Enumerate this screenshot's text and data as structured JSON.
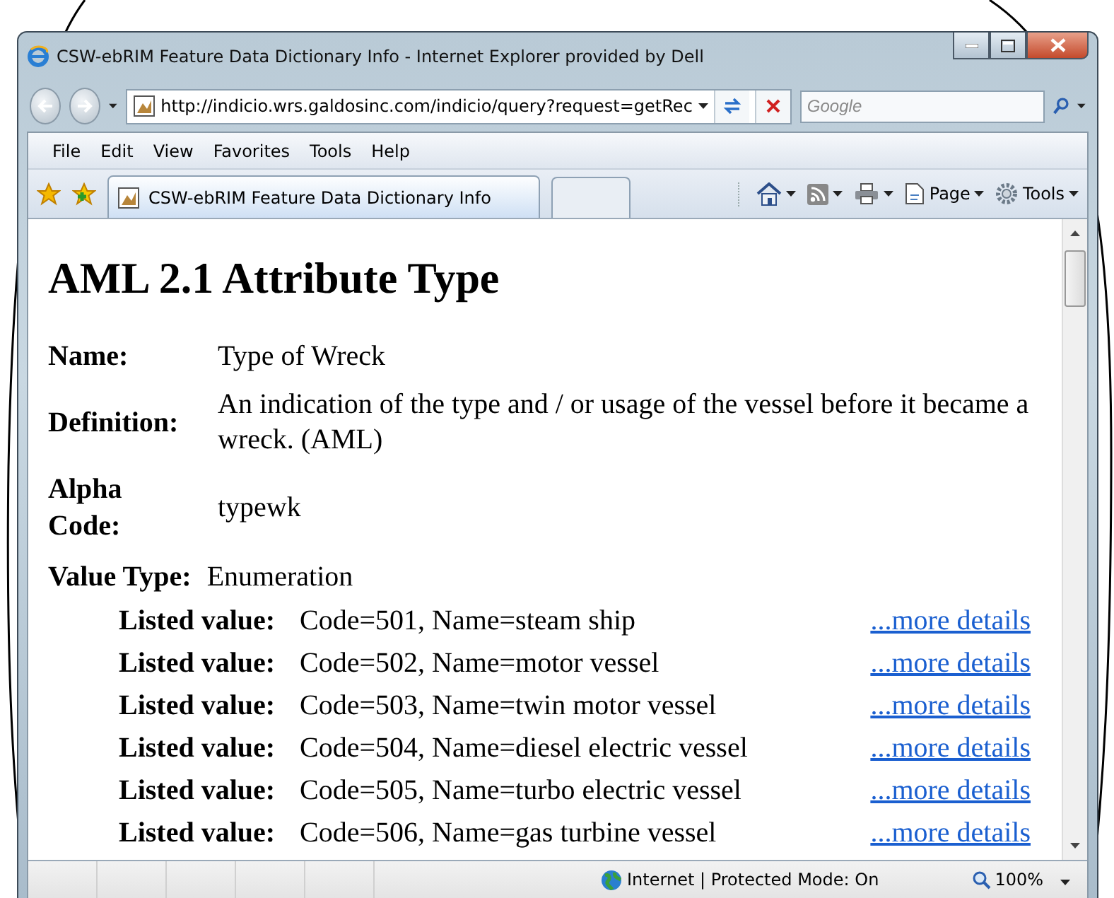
{
  "window": {
    "title": "CSW-ebRIM Feature Data Dictionary Info - Internet Explorer provided by Dell"
  },
  "address": {
    "url": "http://indicio.wrs.galdosinc.com/indicio/query?request=getRec"
  },
  "search": {
    "placeholder": "Google"
  },
  "menu": [
    "File",
    "Edit",
    "View",
    "Favorites",
    "Tools",
    "Help"
  ],
  "tabs": [
    {
      "title": "CSW-ebRIM Feature Data Dictionary Info",
      "selected": true
    }
  ],
  "commands": [
    {
      "kind": "home"
    },
    {
      "kind": "feeds"
    },
    {
      "kind": "print"
    },
    {
      "kind": "page",
      "label": "Page"
    },
    {
      "kind": "tools",
      "label": "Tools"
    }
  ],
  "page": {
    "heading": "AML 2.1 Attribute Type",
    "fields": [
      {
        "label": "Name:",
        "value": "Type of Wreck"
      },
      {
        "label": "Definition:",
        "value": "An indication of the type and / or usage of the vessel before it became a wreck. (AML)"
      },
      {
        "label": "Alpha Code:",
        "value": "typewk"
      }
    ],
    "value_type": {
      "label": "Value Type:",
      "value": "Enumeration"
    },
    "listed_values": [
      {
        "label": "Listed value:",
        "value": "Code=501, Name=steam ship",
        "link": "...more details"
      },
      {
        "label": "Listed value:",
        "value": "Code=502, Name=motor vessel",
        "link": "...more details"
      },
      {
        "label": "Listed value:",
        "value": "Code=503, Name=twin motor vessel",
        "link": "...more details"
      },
      {
        "label": "Listed value:",
        "value": "Code=504, Name=diesel electric vessel",
        "link": "...more details"
      },
      {
        "label": "Listed value:",
        "value": "Code=505, Name=turbo electric vessel",
        "link": "...more details"
      },
      {
        "label": "Listed value:",
        "value": "Code=506, Name=gas turbine vessel",
        "link": "...more details"
      }
    ]
  },
  "status_bar": {
    "zone": "Internet | Protected Mode: On",
    "zoom": "100%"
  }
}
